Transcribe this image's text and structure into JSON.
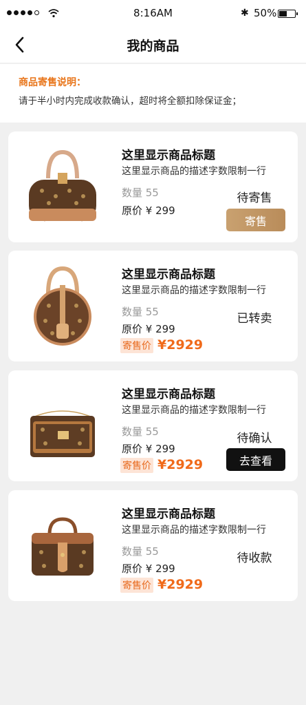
{
  "status_bar": {
    "time": "8:16AM",
    "bluetooth": "✱",
    "battery": "50%",
    "battery_level": 0.5
  },
  "nav": {
    "title": "我的商品"
  },
  "notice": {
    "title": "商品寄售说明：",
    "text": "请于半小时内完成收款确认，超时将全额扣除保证金；"
  },
  "products": [
    {
      "title": "这里显示商品标题",
      "desc": "这里显示商品的描述字数限制一行",
      "qty": "数量 55",
      "orig_price": "原价 ¥ 299",
      "status": "待寄售",
      "action": "寄售"
    },
    {
      "title": "这里显示商品标题",
      "desc": "这里显示商品的描述字数限制一行",
      "qty": "数量 55",
      "orig_price": "原价 ¥ 299",
      "consign_label": "寄售价",
      "consign_price": "¥2929",
      "status": "已转卖"
    },
    {
      "title": "这里显示商品标题",
      "desc": "这里显示商品的描述字数限制一行",
      "qty": "数量 55",
      "orig_price": "原价 ¥ 299",
      "consign_label": "寄售价",
      "consign_price": "¥2929",
      "status": "待确认",
      "action": "去查看"
    },
    {
      "title": "这里显示商品标题",
      "desc": "这里显示商品的描述字数限制一行",
      "qty": "数量 55",
      "orig_price": "原价 ¥ 299",
      "consign_label": "寄售价",
      "consign_price": "¥2929",
      "status": "待收款"
    }
  ],
  "colors": {
    "accent": "#e8751a",
    "price": "#f06a1a",
    "gold_button": "#c29a68",
    "dark_button": "#111111",
    "background": "#f0f0f0"
  }
}
